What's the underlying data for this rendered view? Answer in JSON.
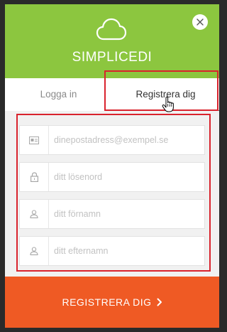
{
  "app": {
    "title": "SIMPLICEDI"
  },
  "header": {
    "icon": "cloud-icon",
    "close_icon": "close-icon"
  },
  "tabs": [
    {
      "label": "Logga in",
      "active": false
    },
    {
      "label": "Registrera dig",
      "active": true
    }
  ],
  "form": {
    "fields": [
      {
        "icon": "id-card-icon",
        "placeholder": "dinepostadress@exempel.se",
        "value": ""
      },
      {
        "icon": "lock-icon",
        "placeholder": "ditt lösenord",
        "value": ""
      },
      {
        "icon": "user-icon",
        "placeholder": "ditt förnamn",
        "value": ""
      },
      {
        "icon": "user-icon",
        "placeholder": "ditt efternamn",
        "value": ""
      }
    ]
  },
  "submit": {
    "label": "REGISTRERA DIG",
    "icon": "chevron-right-icon"
  },
  "colors": {
    "header_green": "#8cc63f",
    "submit_orange": "#ef5a24",
    "highlight_red": "#d9232d",
    "backdrop": "#2a2a2a"
  }
}
